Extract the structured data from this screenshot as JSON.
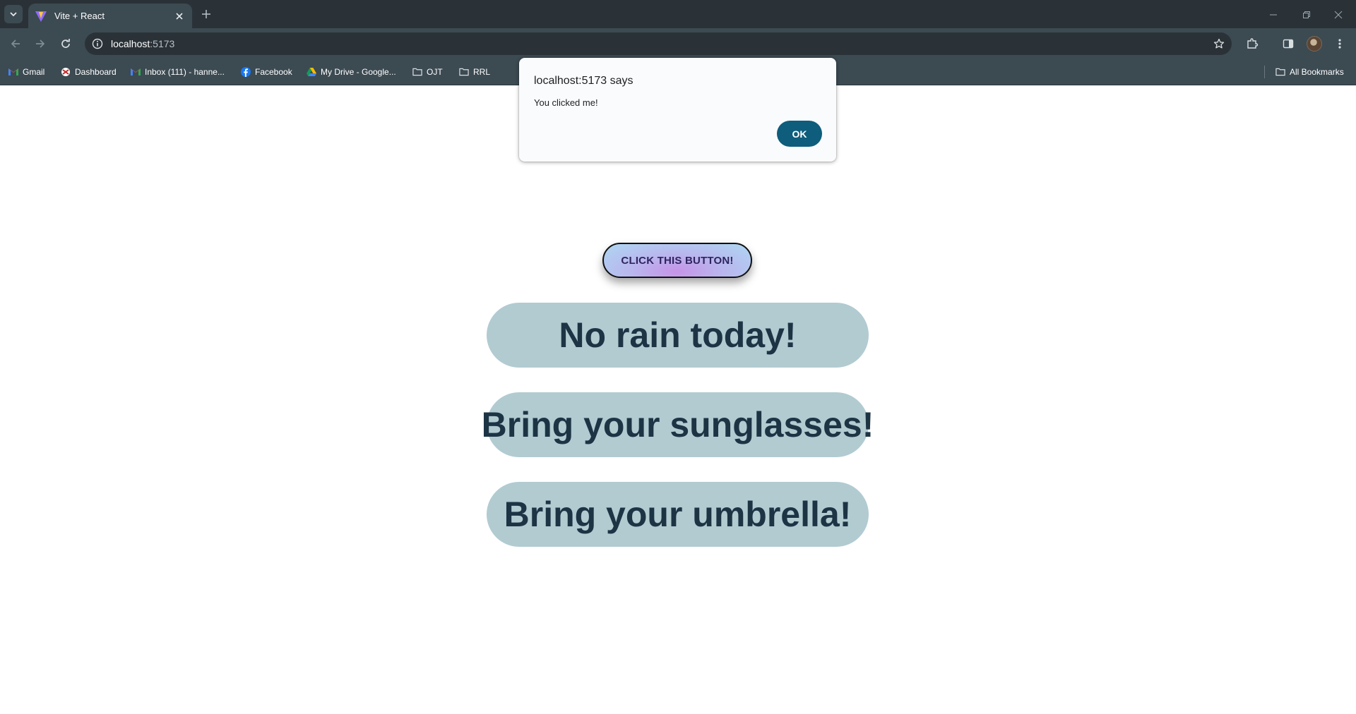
{
  "browser": {
    "tab": {
      "title": "Vite + React"
    },
    "omnibox": {
      "host": "localhost",
      "port": ":5173"
    },
    "bookmarks": [
      {
        "label": "Gmail",
        "icon": "gmail-icon"
      },
      {
        "label": "Dashboard",
        "icon": "dashboard-icon"
      },
      {
        "label": "Inbox (111) - hanne...",
        "icon": "gmail-icon"
      },
      {
        "label": "Facebook",
        "icon": "facebook-icon"
      },
      {
        "label": "My Drive - Google...",
        "icon": "google-drive-icon"
      },
      {
        "label": "OJT",
        "icon": "folder-icon"
      },
      {
        "label": "RRL",
        "icon": "folder-icon"
      }
    ],
    "all_bookmarks_label": "All Bookmarks"
  },
  "page": {
    "button_label": "CLICK THIS BUTTON!",
    "messages": [
      "No rain today!",
      "Bring your sunglasses!",
      "Bring your umbrella!"
    ]
  },
  "dialog": {
    "title": "localhost:5173 says",
    "message": "You clicked me!",
    "ok_label": "OK"
  },
  "colors": {
    "chrome_dark": "#2a3238",
    "chrome": "#3c4a52",
    "pill_bg": "#b1cbd1",
    "pill_text": "#1d3445",
    "ok_button": "#0e5d7c"
  }
}
